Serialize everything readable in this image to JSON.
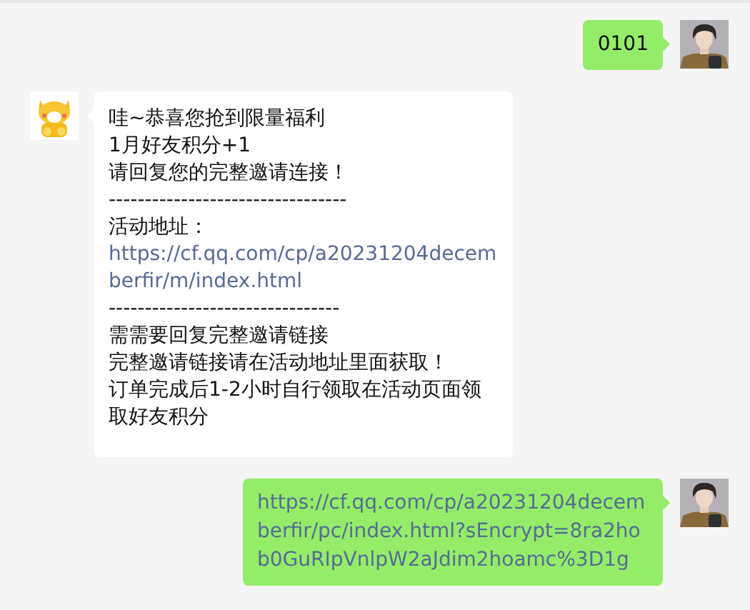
{
  "messages": [
    {
      "kind": "sent",
      "parts": [
        {
          "kind": "text",
          "text": "0101"
        }
      ]
    },
    {
      "kind": "received",
      "parts": [
        {
          "kind": "text",
          "text": "哇~恭喜您抢到限量福利"
        },
        {
          "kind": "text",
          "text": "1月好友积分+1"
        },
        {
          "kind": "text",
          "text": "请回复您的完整邀请连接！"
        },
        {
          "kind": "text",
          "text": "---------------------------------"
        },
        {
          "kind": "labeled_link",
          "label": "活动地址：",
          "text": "https://cf.qq.com/cp/a20231204decemberfir/m/index.html"
        },
        {
          "kind": "text",
          "text": "--------------------------------"
        },
        {
          "kind": "text",
          "text": "需需要回复完整邀请链接"
        },
        {
          "kind": "text",
          "text": "完整邀请链接请在活动地址里面获取！"
        },
        {
          "kind": "text",
          "text": "订单完成后1-2小时自行领取在活动页面领取好友积分"
        }
      ]
    },
    {
      "kind": "sent",
      "parts": [
        {
          "kind": "link",
          "text": "https://cf.qq.com/cp/a20231204decemberfir/pc/index.html?sEncrypt=8ra2hob0GuRIpVnlpW2aJdim2hoamc%3D1g"
        }
      ]
    }
  ]
}
